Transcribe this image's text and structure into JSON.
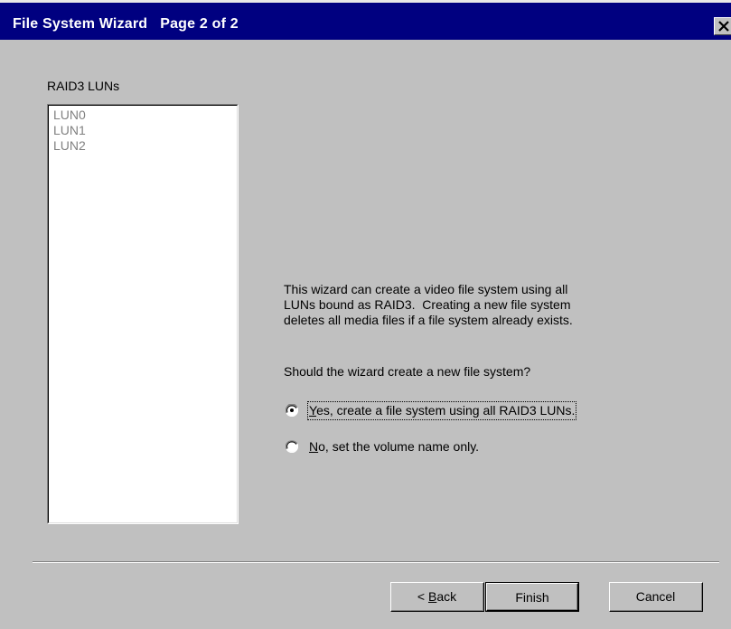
{
  "window": {
    "title": "File System Wizard   Page 2 of 2"
  },
  "lun_list": {
    "label": "RAID3 LUNs",
    "items": [
      "LUN0",
      "LUN1",
      "LUN2"
    ]
  },
  "description": "This wizard can create a video file system using all\nLUNs bound as RAID3.  Creating a new file system\ndeletes all media files if a file system already exists.",
  "question": "Should the wizard create a new file system?",
  "options": {
    "yes": {
      "label_mnemonic": "Y",
      "label_rest": "es, create a file system using all RAID3 LUNs.",
      "selected": true
    },
    "no": {
      "label_mnemonic": "N",
      "label_rest": "o, set the volume name only.",
      "selected": false
    }
  },
  "buttons": {
    "back": {
      "prefix": "< ",
      "mnemonic": "B",
      "rest": "ack"
    },
    "finish": "Finish",
    "cancel": "Cancel"
  },
  "icons": {
    "close": "close-icon",
    "radio_selected": "radio-selected-icon",
    "radio_unselected": "radio-unselected-icon"
  },
  "colors": {
    "title_bar": "#000080",
    "face": "#c0c0c0",
    "disabled_text": "#808080"
  }
}
